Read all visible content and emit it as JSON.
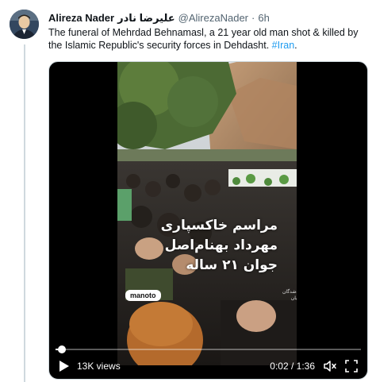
{
  "tweet": {
    "author_name": "Alireza Nader",
    "author_name_fa": "علیرضا نادر",
    "handle": "@AlirezaNader",
    "separator": "·",
    "time": "6h",
    "text": "The funeral of Mehrdad Behnamasl, a 21 year old man shot & killed by the Islamic Republic's security forces in Dehdasht. ",
    "hashtag": "#Iran",
    "trailing": "."
  },
  "video": {
    "overlay_line1": "مراسم خاکسپاری",
    "overlay_line2": "مهرداد بهنام‌اصل",
    "overlay_line3": "جوان ۲۱ ساله",
    "brand": "manoto",
    "watermark": "کشته‌شدگان انقلابیان",
    "views": "13K views",
    "time_display": "0:02 / 1:36",
    "progress_fraction": 0.021
  },
  "colors": {
    "text": "#0f1419",
    "secondary": "#536471",
    "link": "#1d9bf0",
    "border": "#cfd9de"
  },
  "icons": {
    "avatar": "avatar-photo",
    "play": "play-icon",
    "mute": "volume-muted-icon",
    "fullscreen": "fullscreen-icon"
  }
}
